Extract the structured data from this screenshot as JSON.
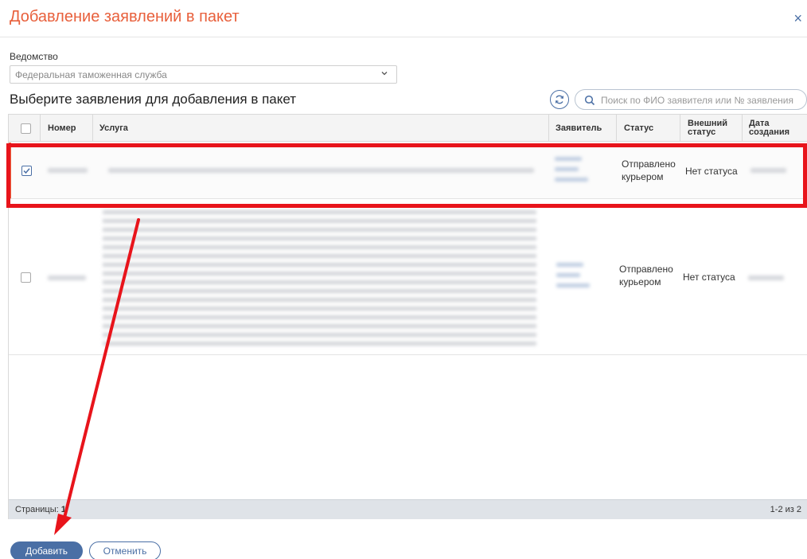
{
  "dialog": {
    "title": "Добавление заявлений в пакет",
    "close_label": "×"
  },
  "department": {
    "label": "Ведомство",
    "selected": "Федеральная таможенная служба"
  },
  "section_title": "Выберите заявления для добавления в пакет",
  "search": {
    "placeholder": "Поиск по ФИО заявителя или № заявления"
  },
  "table": {
    "columns": {
      "number": "Номер",
      "service": "Услуга",
      "applicant": "Заявитель",
      "status": "Статус",
      "external_status": "Внешний статус",
      "created": "Дата создания"
    },
    "rows": [
      {
        "checked": true,
        "status": "Отправлено курьером",
        "external_status": "Нет статуса"
      },
      {
        "checked": false,
        "status": "Отправлено курьером",
        "external_status": "Нет статуса"
      }
    ]
  },
  "pagination": {
    "pages_label": "Страницы:",
    "current_page": "1",
    "range": "1-2 из 2"
  },
  "buttons": {
    "add": "Добавить",
    "cancel": "Отменить"
  },
  "colors": {
    "accent": "#e8603c",
    "primary": "#4a6fa5",
    "annotation": "#e8141b"
  },
  "icons": [
    "close-icon",
    "chevron-down-icon",
    "refresh-icon",
    "search-icon",
    "check-icon"
  ]
}
